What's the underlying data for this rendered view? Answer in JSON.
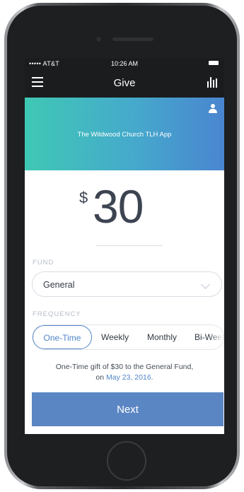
{
  "status": {
    "carrier": "••••• AT&T",
    "time": "10:26 AM"
  },
  "nav": {
    "title": "Give",
    "menu_icon": "hamburger-menu-icon",
    "stats_icon": "bar-chart-icon"
  },
  "banner": {
    "org_name": "The Wildwood Church TLH App",
    "profile_icon": "user-icon",
    "gradient": [
      "#3fc8b4",
      "#4a85d0"
    ]
  },
  "amount": {
    "currency": "$",
    "value": "30"
  },
  "fund": {
    "label": "FUND",
    "selected": "General"
  },
  "frequency": {
    "label": "FREQUENCY",
    "options": [
      "One-Time",
      "Weekly",
      "Monthly",
      "Bi-Weekly"
    ],
    "selected": "One-Time"
  },
  "summary": {
    "line1": "One-Time gift of $30 to the General Fund,",
    "on": "on",
    "date": "May 23, 2016."
  },
  "next_button": {
    "label": "Next"
  },
  "colors": {
    "accent": "#4f86c6",
    "button": "#5b86c4"
  }
}
